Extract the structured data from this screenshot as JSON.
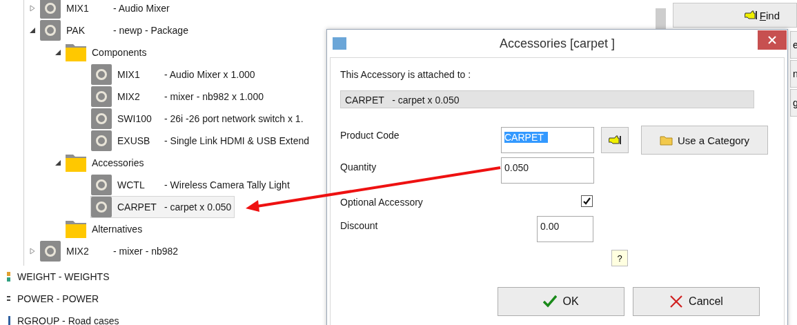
{
  "tree": [
    {
      "kind": "product",
      "code": "MIX1",
      "description": "- Audio Mixer",
      "expanded": false,
      "selected": false
    },
    {
      "kind": "product",
      "code": "PAK",
      "description": "- newp - Package",
      "expanded": true,
      "selected": false,
      "children": [
        {
          "kind": "folder",
          "code": "Components",
          "expanded": true,
          "selected": false,
          "children": [
            {
              "kind": "product",
              "code": "MIX1",
              "description": "- Audio Mixer x 1.000",
              "selected": false
            },
            {
              "kind": "product",
              "code": "MIX2",
              "description": "- mixer - nb982 x 1.000",
              "selected": false
            },
            {
              "kind": "product",
              "code": "SWI100",
              "description": "- 26i -26 port network switch x 1.",
              "selected": false
            },
            {
              "kind": "product",
              "code": "EXUSB",
              "description": "- Single Link HDMI & USB Extend",
              "selected": false
            }
          ]
        },
        {
          "kind": "folder",
          "code": "Accessories",
          "expanded": true,
          "selected": false,
          "children": [
            {
              "kind": "product",
              "code": "WCTL",
              "description": "- Wireless Camera Tally Light",
              "selected": false
            },
            {
              "kind": "product",
              "code": "CARPET",
              "description": "- carpet x 0.050",
              "selected": true
            }
          ]
        },
        {
          "kind": "folder",
          "code": "Alternatives",
          "selected": false
        }
      ]
    },
    {
      "kind": "product",
      "code": "MIX2",
      "description": "- mixer - nb982",
      "expanded": false,
      "selected": false
    }
  ],
  "categories": [
    {
      "kind": "weight",
      "label": "WEIGHT - WEIGHTS"
    },
    {
      "kind": "power",
      "label": "POWER - POWER"
    },
    {
      "kind": "group",
      "label": "RGROUP - Road cases"
    }
  ],
  "find_button": {
    "label": "Find"
  },
  "side_tabs": [
    "e",
    "n",
    "g"
  ],
  "dialog": {
    "title": "Accessories [carpet ]",
    "attached_label": "This Accessory is attached to :",
    "attached_value": "CARPET   - carpet x 0.050",
    "product_code": {
      "label": "Product Code",
      "value": "CARPET",
      "text_selected": true
    },
    "category_button": "Use a Category",
    "quantity": {
      "label": "Quantity",
      "value": "0.050"
    },
    "optional": {
      "label": "Optional Accessory",
      "checked": true
    },
    "discount": {
      "label": "Discount",
      "value": "0.00"
    },
    "help": "?",
    "buttons": [
      {
        "kind": "ok",
        "label": "OK"
      },
      {
        "kind": "cancel",
        "label": "Cancel"
      }
    ]
  }
}
